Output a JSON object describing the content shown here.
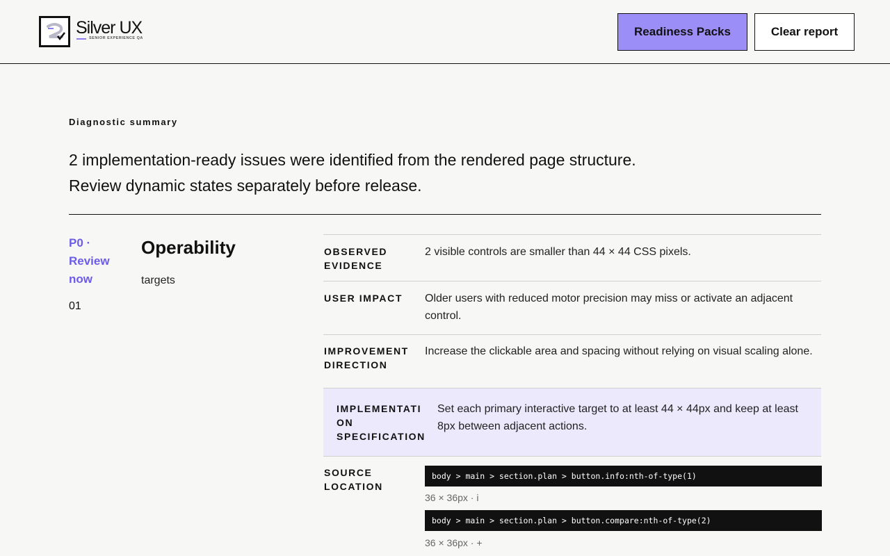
{
  "header": {
    "logo_title": "Silver UX",
    "logo_subtitle": "SENIOR EXPERIENCE QA",
    "packs_button": "Readiness Packs",
    "clear_button": "Clear report"
  },
  "summary": {
    "label": "Diagnostic summary",
    "line1": "2 implementation-ready issues were identified from the rendered page structure.",
    "line2": "Review dynamic states separately before release."
  },
  "issue": {
    "priority": "P0 · Review now",
    "number": "01",
    "title": "Operability",
    "subtitle": "targets",
    "observed_label": "OBSERVED EVIDENCE",
    "observed_value": "2 visible controls are smaller than 44 × 44 CSS pixels.",
    "impact_label": "USER IMPACT",
    "impact_value": "Older users with reduced motor precision may miss or activate an adjacent control.",
    "direction_label": "IMPROVEMENT DIRECTION",
    "direction_value": "Increase the clickable area and spacing without relying on visual scaling alone.",
    "spec_label": "IMPLEMENTATI ON SPECIFICATION",
    "spec_value": "Set each primary interactive target to at least 44 × 44px and keep at least 8px between adjacent actions.",
    "source_label": "SOURCE LOCATION",
    "sources": [
      {
        "selector": "body > main > section.plan > button.info:nth-of-type(1)",
        "meta": "36 × 36px · i"
      },
      {
        "selector": "body > main > section.plan > button.compare:nth-of-type(2)",
        "meta": "36 × 36px · +"
      }
    ]
  },
  "colors": {
    "accent": "#9b8ff7",
    "priority": "#6c5ce7",
    "spec_background": "#ece9fd",
    "code_background": "#111111"
  }
}
